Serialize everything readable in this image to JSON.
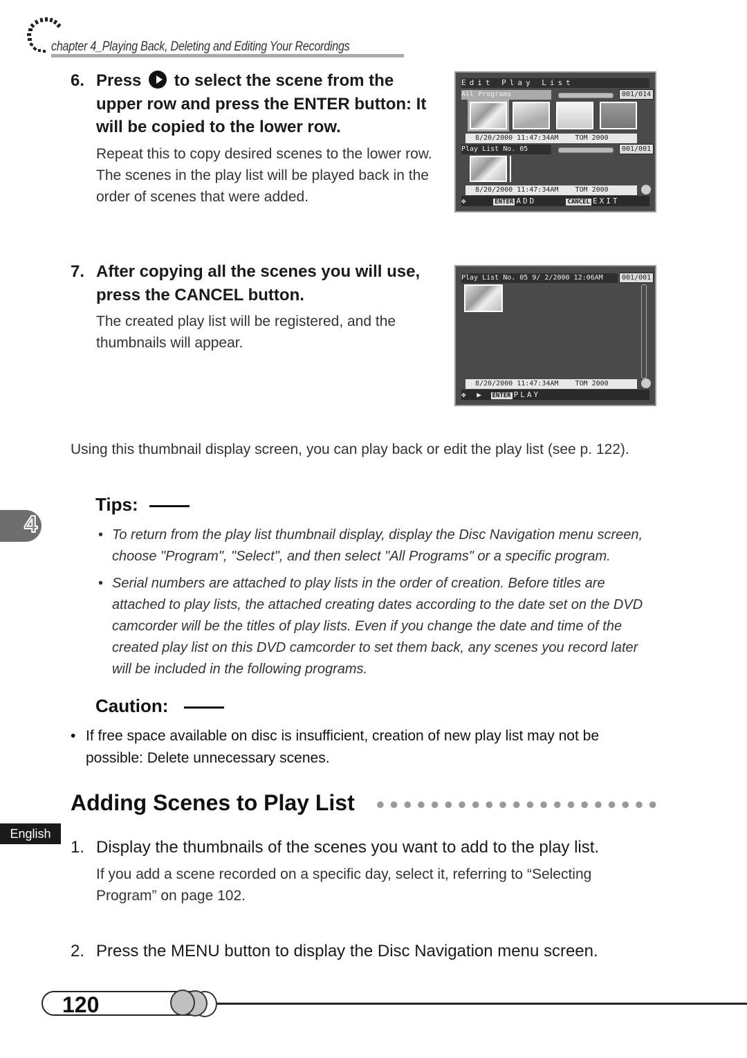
{
  "header": {
    "chapter_title": "chapter 4_Playing Back, Deleting and Editing Your Recordings",
    "icon": "dotted-arc-icon"
  },
  "steps_top": [
    {
      "number": "6.",
      "heading_before_icon": "Press",
      "icon": "right-arrow-button-icon",
      "heading_after_icon": "to select the scene from the upper row and press the ENTER button: It will be copied to the lower row.",
      "body": "Repeat this to copy desired scenes to the lower row. The scenes in the play list will be played back in the order of scenes that were added."
    },
    {
      "number": "7.",
      "heading": "After copying all the scenes you will use, press the CANCEL button.",
      "body": "The created play list will be registered, and the thumbnails will appear."
    }
  ],
  "screen1": {
    "title": "Edit Play List",
    "upper_label": "All Programs",
    "upper_count": "001/014",
    "upper_info_date": "8/20/2000 11:47:34AM",
    "upper_info_title": "TOM 2000",
    "lower_label": "Play List No. 05",
    "lower_count": "001/001",
    "lower_info_date": "8/20/2000 11:47:34AM",
    "lower_info_title": "TOM 2000",
    "footer_enter_tag": "ENTER",
    "footer_enter_label": "ADD",
    "footer_cancel_tag": "CANCEL",
    "footer_cancel_label": "EXIT"
  },
  "screen2": {
    "title": "Play List No. 05   9/ 2/2000 12:06AM",
    "count": "001/001",
    "info_date": "8/20/2000 11:47:34AM",
    "info_title": "TOM 2000",
    "footer_enter_tag": "ENTER",
    "footer_enter_label": "PLAY"
  },
  "note": "Using this thumbnail display screen, you can play back or edit the play list (see p. 122).",
  "tips": {
    "label": "Tips:",
    "items": [
      "To return from the play list thumbnail display, display the Disc Navigation menu screen, choose \"Program\", \"Select\", and then select \"All Programs\" or a specific program.",
      "Serial numbers are attached to play lists in the order of creation. Before titles are attached to play lists, the attached creating dates according to the date set on the DVD camcorder will be the titles of play lists. Even if you change the date and time of the created play list on this DVD camcorder to set them back, any scenes you record later will be included in the following programs."
    ]
  },
  "caution": {
    "label": "Caution:",
    "items": [
      "If free space available on disc is insufficient, creation of new play list may not be possible: Delete unnecessary scenes."
    ]
  },
  "side_tabs": {
    "chapter_number": "4",
    "language": "English"
  },
  "section": {
    "title": "Adding Scenes to Play List",
    "steps": [
      {
        "number": "1.",
        "heading": "Display the thumbnails of the scenes you want to add to the play list.",
        "body": "If you add a scene recorded on a specific day, select it, referring to “Selecting Program” on page 102."
      },
      {
        "number": "2.",
        "heading": "Press the MENU button to display the Disc Navigation menu screen.",
        "body": ""
      }
    ]
  },
  "footer": {
    "page_number": "120"
  }
}
